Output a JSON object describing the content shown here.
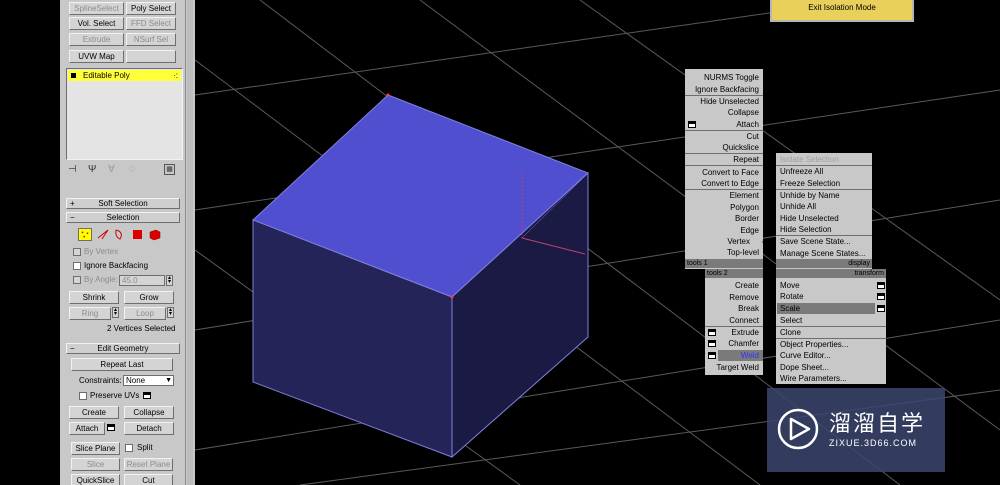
{
  "panel": {
    "top_buttons": [
      {
        "label": "SplineSelect",
        "enabled": false
      },
      {
        "label": "Poly Select",
        "enabled": true
      },
      {
        "label": "Vol. Select",
        "enabled": true
      },
      {
        "label": "FFD Select",
        "enabled": false
      },
      {
        "label": "Extrude",
        "enabled": false
      },
      {
        "label": "NSurf Sel",
        "enabled": false
      },
      {
        "label": "UVW Map",
        "enabled": true
      },
      {
        "label": "",
        "enabled": true
      }
    ],
    "stack_item": "Editable Poly",
    "soft_selection": "Soft Selection",
    "selection": {
      "title": "Selection",
      "by_vertex": "By Vertex",
      "ignore_backfacing": "Ignore Backfacing",
      "by_angle": "By Angle:",
      "angle_value": "45.0",
      "shrink": "Shrink",
      "grow": "Grow",
      "ring": "Ring",
      "loop": "Loop",
      "status": "2 Vertices Selected"
    },
    "edit_geometry": {
      "title": "Edit Geometry",
      "repeat_last": "Repeat Last",
      "constraints_label": "Constraints:",
      "constraints_value": "None",
      "preserve_uvs": "Preserve UVs",
      "create": "Create",
      "collapse": "Collapse",
      "attach": "Attach",
      "detach": "Detach",
      "slice_plane": "Slice Plane",
      "split": "Split",
      "slice": "Slice",
      "reset_plane": "Reset Plane",
      "quickslice": "QuickSlice",
      "cut": "Cut"
    }
  },
  "isolation": {
    "label": "Exit Isolation Mode"
  },
  "quad_menu": {
    "tools1_items": [
      "NURMS Toggle",
      "Ignore Backfacing",
      "Hide Unselected",
      "Collapse",
      "Attach",
      "Cut",
      "Quickslice",
      "Repeat",
      "Convert to Face",
      "Convert to Edge",
      "Element",
      "Polygon",
      "Border",
      "Edge",
      "Vertex",
      "Top-level"
    ],
    "tools1_label": "tools 1",
    "display_items": [
      "Isolate Selection",
      "Unfreeze All",
      "Freeze Selection",
      "Unhide by Name",
      "Unhide All",
      "Hide Unselected",
      "Hide Selection",
      "Save Scene State...",
      "Manage Scene States..."
    ],
    "display_label": "display",
    "tools2_label": "tools 2",
    "tools2_items": [
      "Create",
      "Remove",
      "Break",
      "Connect",
      "Extrude",
      "Chamfer",
      "Weld",
      "Target Weld"
    ],
    "transform_label": "transform",
    "transform_items": [
      "Move",
      "Rotate",
      "Scale",
      "Select",
      "Clone",
      "Object Properties...",
      "Curve Editor...",
      "Dope Sheet...",
      "Wire Parameters..."
    ],
    "checked_item": "Vertex",
    "highlighted_item": "Scale",
    "active_tools2_item": "Weld"
  },
  "watermark": {
    "brand": "溜溜自学",
    "url": "ZIXUE.3D66.COM"
  },
  "colors": {
    "cube_top": "#4f4fd0",
    "cube_front": "#242458",
    "stack_highlight": "#ffff3a",
    "isolation": "#e8d05a"
  }
}
